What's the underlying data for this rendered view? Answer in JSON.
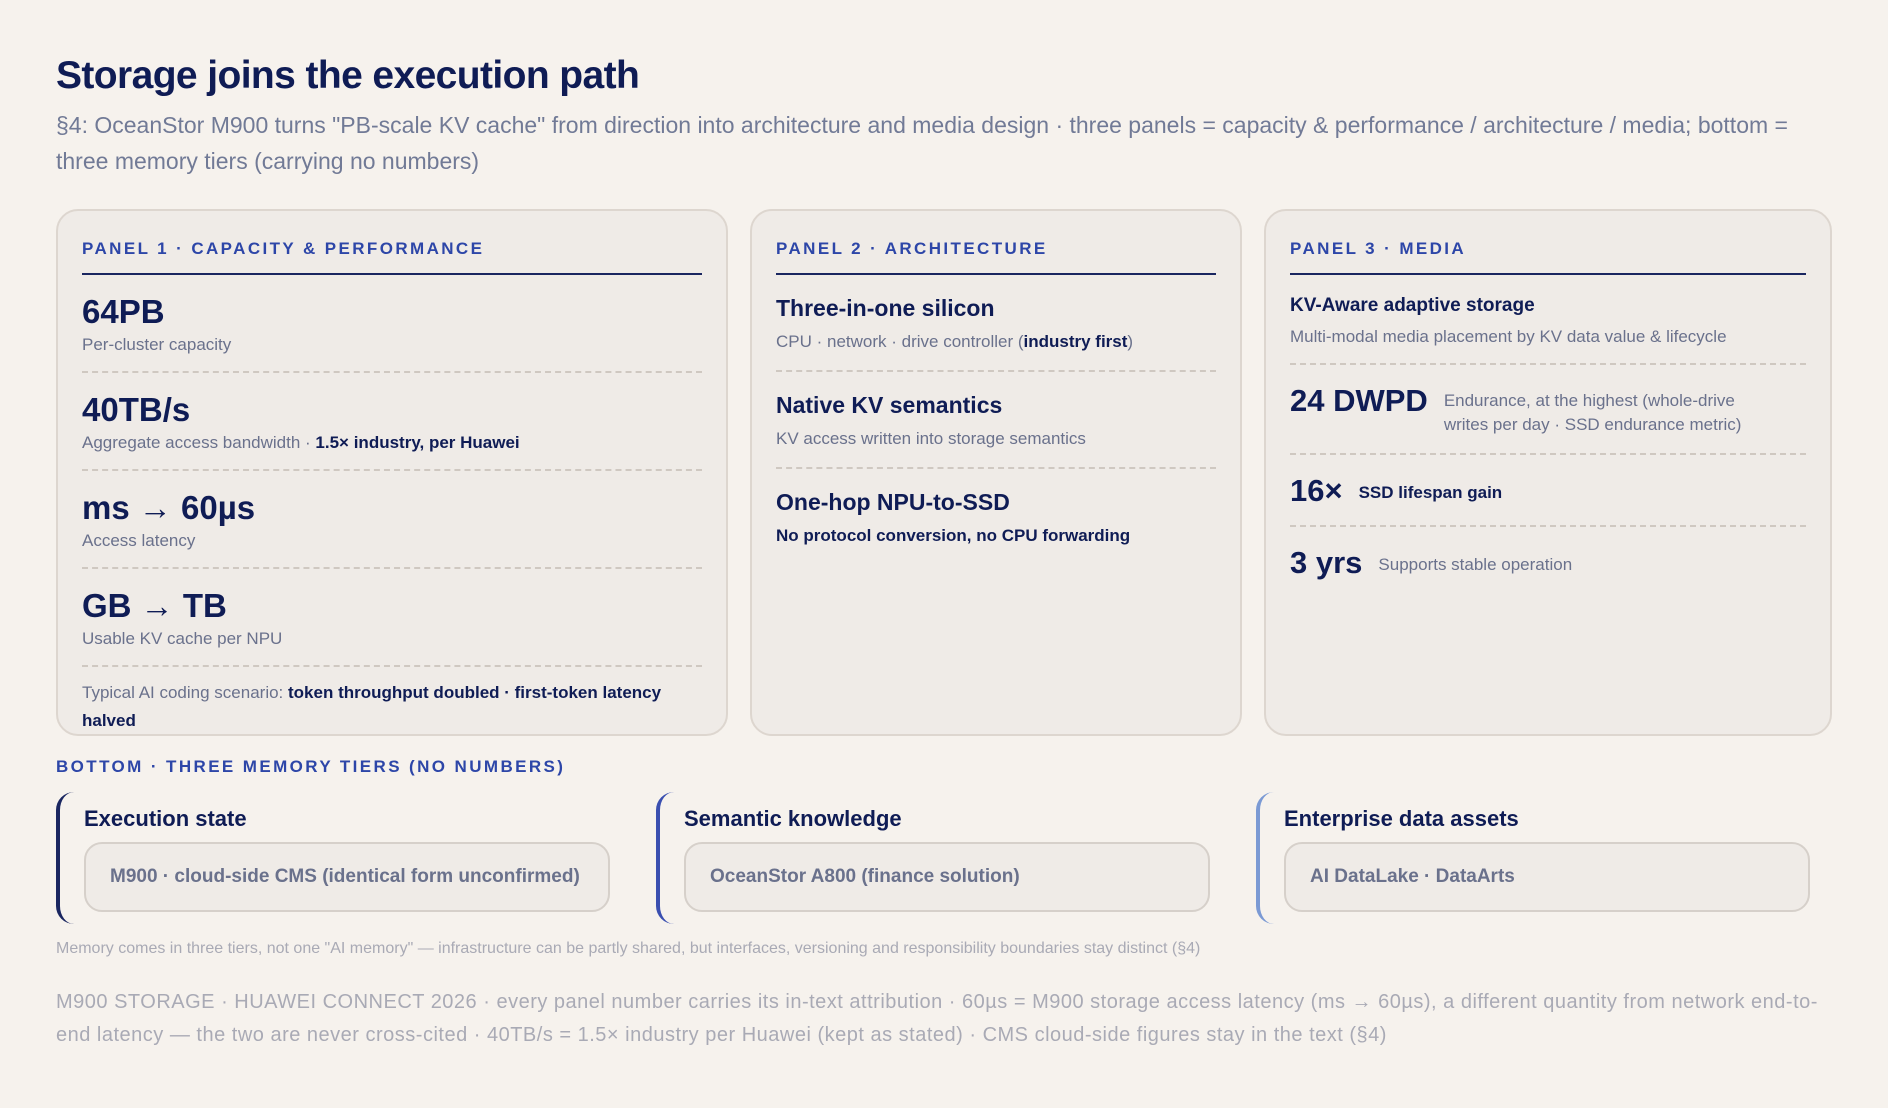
{
  "header": {
    "title": "Storage joins the execution path",
    "subtitle": "§4: OceanStor M900 turns \"PB-scale KV cache\" from direction into architecture and media design · three panels = capacity & performance / architecture / media; bottom = three memory tiers (carrying no numbers)"
  },
  "panel1": {
    "heading": "PANEL 1 · CAPACITY & PERFORMANCE",
    "metrics": [
      {
        "value": "64PB",
        "label": "Per-cluster capacity",
        "label_strong": ""
      },
      {
        "value": "40TB/s",
        "label": "Aggregate access bandwidth · ",
        "label_strong": "1.5× industry, per Huawei"
      },
      {
        "value": "ms → 60µs",
        "label": "Access latency",
        "label_strong": ""
      },
      {
        "value": "GB → TB",
        "label": "Usable KV cache per NPU",
        "label_strong": ""
      }
    ],
    "note_prefix": "Typical AI coding scenario: ",
    "note_strong": "token throughput doubled · first-token latency halved"
  },
  "panel2": {
    "heading": "PANEL 2 · ARCHITECTURE",
    "items": [
      {
        "title": "Three-in-one silicon",
        "sub": "CPU · network · drive controller (",
        "sub_strong": "industry first",
        "sub_end": ")"
      },
      {
        "title": "Native KV semantics",
        "sub": "KV access written into storage semantics"
      },
      {
        "title": "One-hop NPU-to-SSD",
        "sub": "No protocol conversion, no CPU forwarding"
      }
    ]
  },
  "panel3": {
    "heading": "PANEL 3 · MEDIA",
    "intro_title": "KV-Aware adaptive storage",
    "intro_sub": "Multi-modal media placement by KV data value & lifecycle",
    "rows": [
      {
        "value": "24 DWPD",
        "label": "Endurance, at the highest (whole-drive writes per day · SSD endurance metric)"
      },
      {
        "value": "16×",
        "label": "SSD lifespan gain"
      },
      {
        "value": "3 yrs",
        "label": "Supports stable operation"
      }
    ]
  },
  "bottom": {
    "heading": "BOTTOM · THREE MEMORY TIERS (NO NUMBERS)",
    "tiers": [
      {
        "title": "Execution state",
        "box": "M900 · cloud-side CMS (identical form unconfirmed)"
      },
      {
        "title": "Semantic knowledge",
        "box": "OceanStor A800 (finance solution)"
      },
      {
        "title": "Enterprise data assets",
        "box": "AI DataLake · DataArts"
      }
    ],
    "footnote": "Memory comes in three tiers, not one \"AI memory\" — infrastructure can be partly shared, but interfaces, versioning and responsibility boundaries stay distinct (§4)"
  },
  "footer": {
    "text": "M900 STORAGE · HUAWEI CONNECT 2026 · every panel number carries its in-text attribution · 60µs = M900 storage access latency (ms → 60µs), a different quantity from network end-to-end latency — the two are never cross-cited · 40TB/s = 1.5× industry per Huawei (kept as stated) · CMS cloud-side figures stay in the text (§4)"
  },
  "colors": {
    "background": "#f6f2ed",
    "navy": "#0f1c55",
    "accent_blue": "#2d46a8",
    "muted": "#6a718c"
  }
}
